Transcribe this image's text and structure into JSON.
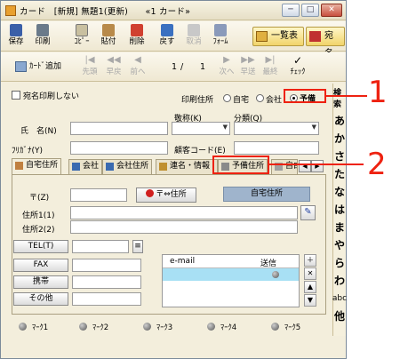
{
  "window": {
    "title": "カード　[新規] 無題1(更新)　　«1 カード»"
  },
  "toolbar1": {
    "save": "保存",
    "print": "印刷",
    "copy": "ｺﾋﾟｰ",
    "paste": "貼付",
    "delete": "削除",
    "back": "戻す",
    "cancel": "取消",
    "form": "ﾌｫｰﾑ",
    "list": "一覧表",
    "address": "宛 名"
  },
  "toolbar2": {
    "card_add": "ｶｰﾄﾞ追加",
    "first": "先頭",
    "prev_fast": "早戻",
    "prev": "前へ",
    "page_current": "1",
    "page_sep": "/",
    "page_total": "1",
    "next": "次へ",
    "next_fast": "早送",
    "last": "最終",
    "check": "ﾁｪｯｸ"
  },
  "form": {
    "no_address_print": "宛名印刷しない",
    "print_address_label": "印刷住所",
    "radio_home": "自宅",
    "radio_company": "会社",
    "radio_reserve": "予備",
    "honorific_label": "敬称(K)",
    "category_label": "分類(Q)",
    "name_label": "氏　名(N)",
    "kana_label": "ﾌﾘｶﾞﾅ(Y)",
    "customer_code_label": "顧客コード(E)",
    "tabs": [
      "自宅住所",
      "会社",
      "会社住所",
      "連名・情報",
      "予備住所",
      "自由"
    ],
    "zip_label": "〒(Z)",
    "zip_swap_button": "〒⇔住所",
    "home_address_box": "自宅住所",
    "address1_label": "住所1(1)",
    "address2_label": "住所2(2)",
    "tel_button": "TEL(T)",
    "fax_button": "FAX",
    "mobile_button": "携帯",
    "other_button": "その他",
    "email_header": "e-mail",
    "send_header": "送信"
  },
  "kana_index": {
    "header": "検索",
    "letters": [
      "あ",
      "か",
      "さ",
      "た",
      "な",
      "は",
      "ま",
      "や",
      "ら",
      "わ",
      "abc",
      "他"
    ]
  },
  "marks": [
    "ﾏｰｸ1",
    "ﾏｰｸ2",
    "ﾏｰｸ3",
    "ﾏｰｸ4",
    "ﾏｰｸ5"
  ],
  "callouts": [
    "1",
    "2"
  ]
}
